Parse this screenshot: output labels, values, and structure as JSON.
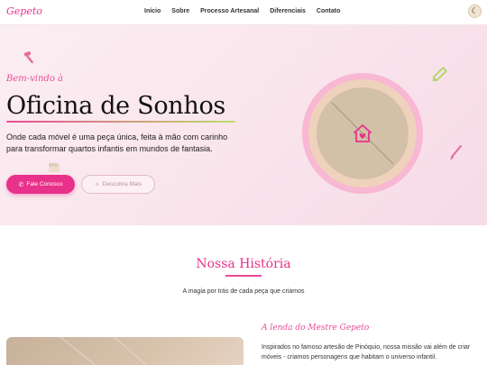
{
  "brand": {
    "logo": "Gepeto"
  },
  "nav": {
    "items": [
      "Início",
      "Sobre",
      "Processo Artesanal",
      "Diferenciais",
      "Contato"
    ]
  },
  "hero": {
    "welcome": "Bem-vindo à",
    "title": "Oficina de Sonhos",
    "description": "Onde cada móvel é uma peça única, feita à mão com carinho para transformar quartos infantis em mundos de fantasia.",
    "primary_button": "Fale Conosco",
    "secondary_button": "Descubra Mais"
  },
  "history": {
    "title": "Nossa História",
    "subtitle": "A magia por trás de cada peça que criamos",
    "story_title": "A lenda do Mestre Gepeto",
    "story_text": "Inspirados no famoso artesão de Pinóquio, nossa missão vai além de criar móveis - criamos personagens que habitam o universo infantil."
  },
  "colors": {
    "accent": "#e8318a",
    "accent_light": "#ea4b96",
    "lime": "#b8e06a"
  },
  "icons": [
    "moon-icon",
    "whatsapp-icon",
    "arrow-icon",
    "hammer-icon",
    "pencil-icon",
    "brush-icon",
    "house-heart-icon"
  ]
}
